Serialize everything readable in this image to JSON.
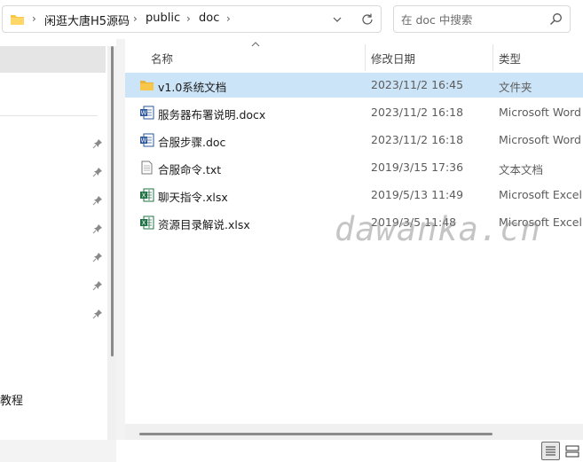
{
  "address_bar": {
    "breadcrumbs": [
      "闲逛大唐H5源码",
      "public",
      "doc"
    ],
    "separator": "›"
  },
  "search": {
    "placeholder": "在 doc 中搜索"
  },
  "columns": {
    "name": "名称",
    "date_modified": "修改日期",
    "type": "类型"
  },
  "files": [
    {
      "name": "v1.0系统文档",
      "date": "2023/11/2 16:45",
      "type": "文件夹",
      "icon": "folder-icon",
      "selected": true
    },
    {
      "name": "服务器布署说明.docx",
      "date": "2023/11/2 16:18",
      "type": "Microsoft Word ",
      "icon": "word-doc-icon",
      "selected": false
    },
    {
      "name": "合服步骤.doc",
      "date": "2023/11/2 16:18",
      "type": "Microsoft Word ",
      "icon": "word-doc-icon",
      "selected": false
    },
    {
      "name": "合服命令.txt",
      "date": "2019/3/15 17:36",
      "type": "文本文档",
      "icon": "text-file-icon",
      "selected": false
    },
    {
      "name": "聊天指令.xlsx",
      "date": "2019/5/13 11:49",
      "type": "Microsoft Excel ...",
      "icon": "excel-file-icon",
      "selected": false
    },
    {
      "name": "资源目录解说.xlsx",
      "date": "2019/3/5 11:48",
      "type": "Microsoft Excel ...",
      "icon": "excel-file-icon",
      "selected": false
    }
  ],
  "nav": {
    "partial_item": "教程"
  },
  "watermark": "dawanka.cn",
  "colors": {
    "selection": "#cce4f7",
    "folder": "#f8c74a",
    "word": "#2b579a",
    "excel": "#217346"
  }
}
